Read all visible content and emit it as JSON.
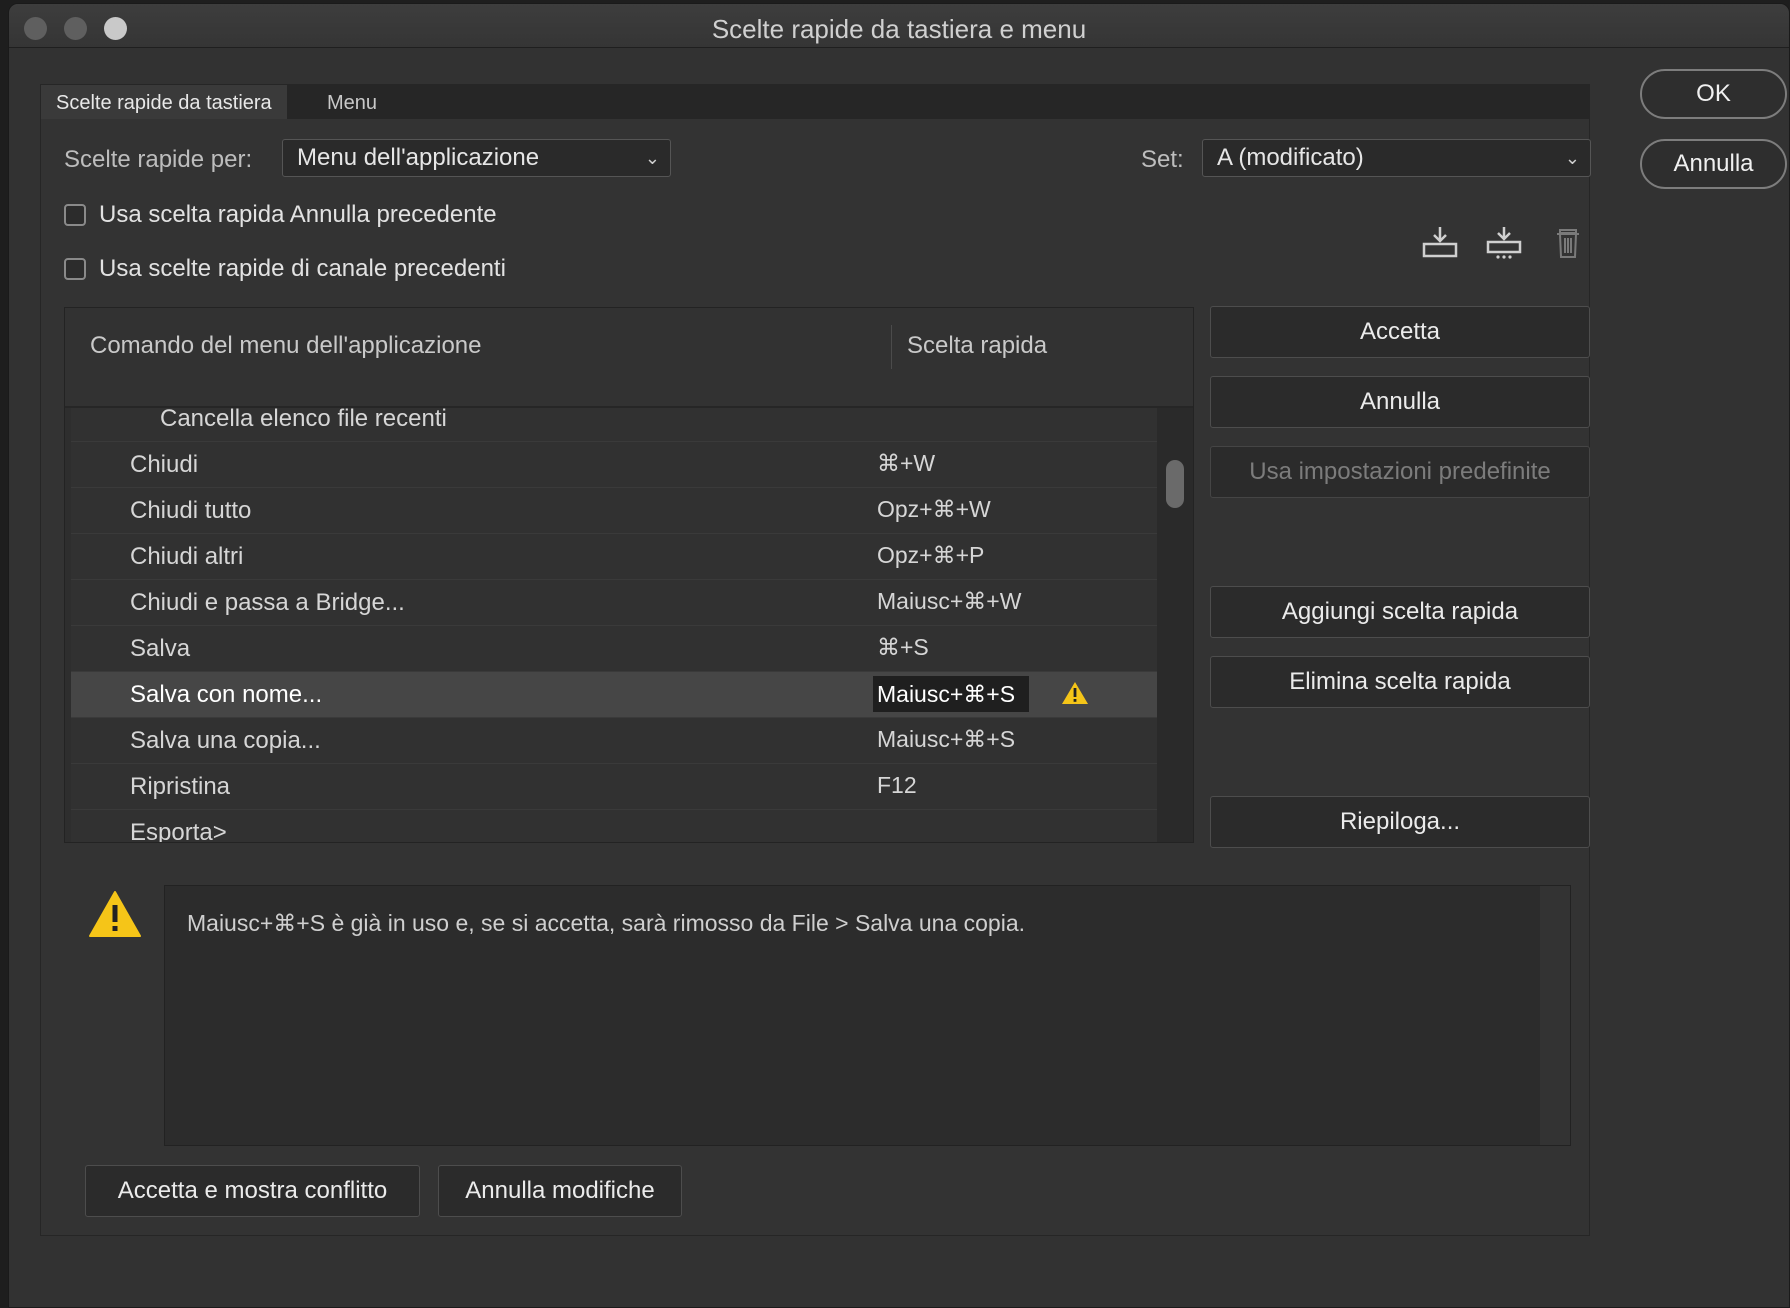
{
  "window": {
    "title": "Scelte rapide da tastiera e menu"
  },
  "tabs": [
    {
      "label": "Scelte rapide da tastiera",
      "active": true
    },
    {
      "label": "Menu",
      "active": false
    }
  ],
  "shortcuts_for": {
    "label": "Scelte rapide per:",
    "value": "Menu dell'applicazione"
  },
  "set": {
    "label": "Set:",
    "value": "A (modificato)"
  },
  "options": [
    {
      "label": "Usa scelta rapida Annulla precedente",
      "checked": false
    },
    {
      "label": "Usa scelte rapide di canale precedenti",
      "checked": false
    }
  ],
  "toolbar_icons": [
    "save-set-icon",
    "save-set-as-icon",
    "trash-icon"
  ],
  "table": {
    "columns": [
      "Comando del menu dell'applicazione",
      "Scelta rapida"
    ],
    "rows": [
      {
        "command": "Cancella elenco file recenti",
        "shortcut": ""
      },
      {
        "command": "Chiudi",
        "shortcut": "⌘+W"
      },
      {
        "command": "Chiudi tutto",
        "shortcut": "Opz+⌘+W"
      },
      {
        "command": "Chiudi altri",
        "shortcut": "Opz+⌘+P"
      },
      {
        "command": "Chiudi e passa a Bridge...",
        "shortcut": "Maiusc+⌘+W"
      },
      {
        "command": "Salva",
        "shortcut": "⌘+S"
      },
      {
        "command": "Salva con nome...",
        "shortcut": "Maiusc+⌘+S",
        "selected": true,
        "conflict": true
      },
      {
        "command": "Salva una copia...",
        "shortcut": "Maiusc+⌘+S"
      },
      {
        "command": "Ripristina",
        "shortcut": "F12"
      },
      {
        "command": "Esporta>",
        "shortcut": ""
      }
    ]
  },
  "side_buttons": {
    "accept": "Accetta",
    "cancel": "Annulla",
    "defaults": "Usa impostazioni predefinite",
    "add": "Aggiungi scelta rapida",
    "delete": "Elimina scelta rapida",
    "summarize": "Riepiloga..."
  },
  "dialog_buttons": {
    "ok": "OK",
    "cancel": "Annulla"
  },
  "message": "Maiusc+⌘+S è già in uso e, se si accetta, sarà rimosso da File > Salva una copia.",
  "bottom_buttons": {
    "accept_show_conflict": "Accetta e mostra conflitto",
    "undo_changes": "Annulla modifiche"
  },
  "colors": {
    "warning": "#f5c518",
    "background": "#323232"
  }
}
